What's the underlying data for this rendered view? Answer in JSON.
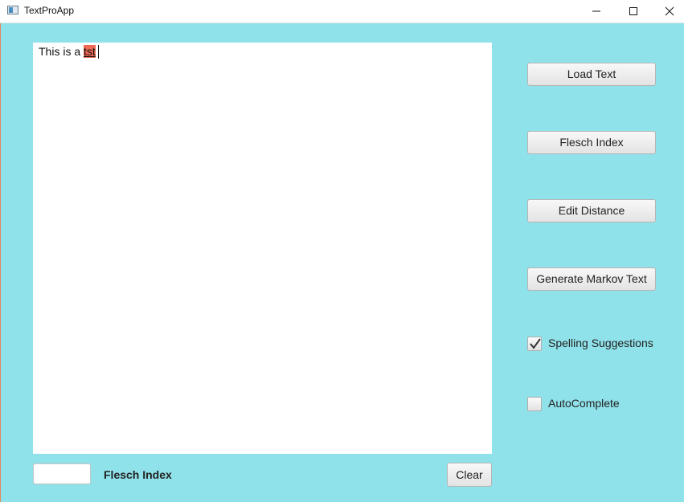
{
  "window": {
    "title": "TextProApp"
  },
  "editor": {
    "text_before": "This is a ",
    "misspelled_word": "tst"
  },
  "sidebar": {
    "load_text": "Load Text",
    "flesch_index": "Flesch Index",
    "edit_distance": "Edit Distance",
    "generate_markov": "Generate Markov Text",
    "spelling_suggestions": {
      "label": "Spelling Suggestions",
      "checked": true
    },
    "autocomplete": {
      "label": "AutoComplete",
      "checked": false
    }
  },
  "bottom": {
    "flesch_value": "",
    "flesch_label": "Flesch Index",
    "clear_label": "Clear"
  },
  "colors": {
    "background": "#90e2ea",
    "misspelled_highlight": "#ee6a55"
  }
}
